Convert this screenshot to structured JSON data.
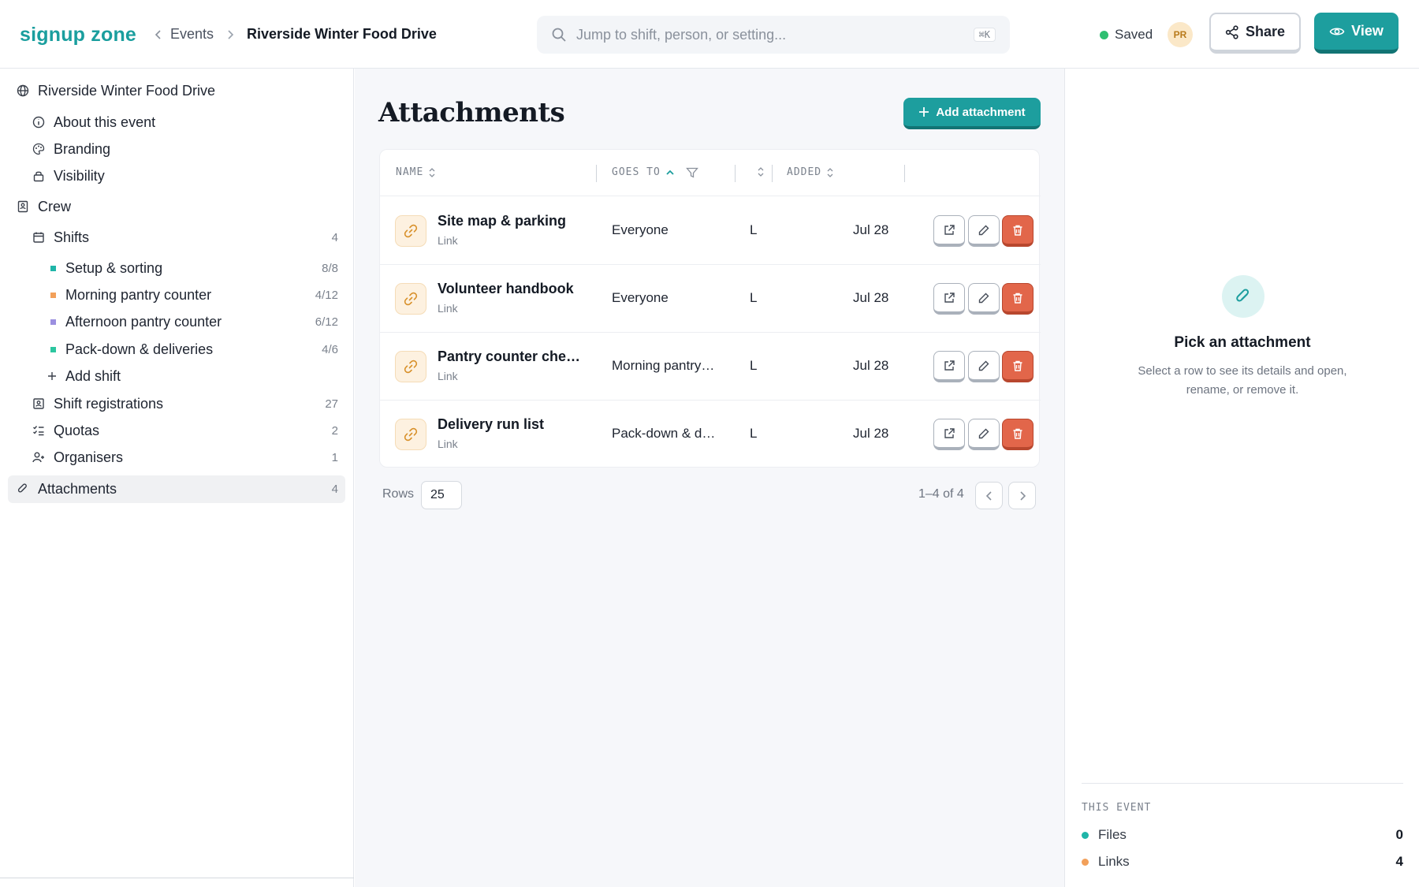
{
  "app": {
    "logo": "signup zone"
  },
  "breadcrumb": {
    "parent": "Events",
    "current": "Riverside Winter Food Drive"
  },
  "search": {
    "placeholder": "Jump to shift, person, or setting...",
    "shortcut": "⌘K"
  },
  "status": {
    "saved": "Saved",
    "avatar": "PR"
  },
  "header_buttons": {
    "share": "Share",
    "view": "View"
  },
  "sidebar": {
    "event": "Riverside Winter Food Drive",
    "about": "About this event",
    "branding": "Branding",
    "visibility": "Visibility",
    "crew": "Crew",
    "shifts": {
      "label": "Shifts",
      "count": "4"
    },
    "shift_items": [
      {
        "label": "Setup & sorting",
        "count": "8/8",
        "color": "#1fb5a8"
      },
      {
        "label": "Morning pantry counter",
        "count": "4/12",
        "color": "#f2a05a"
      },
      {
        "label": "Afternoon pantry counter",
        "count": "6/12",
        "color": "#9b8fe0"
      },
      {
        "label": "Pack-down & deliveries",
        "count": "4/6",
        "color": "#2cc6a0"
      }
    ],
    "add_shift": "Add shift",
    "registrations": {
      "label": "Shift registrations",
      "count": "27"
    },
    "quotas": {
      "label": "Quotas",
      "count": "2"
    },
    "organisers": {
      "label": "Organisers",
      "count": "1"
    },
    "attachments": {
      "label": "Attachments",
      "count": "4"
    }
  },
  "main": {
    "title": "Attachments",
    "add_button": "Add attachment",
    "columns": {
      "name": "NAME",
      "goes_to": "GOES TO",
      "added": "ADDED"
    },
    "rows": [
      {
        "name": "Site map & parking",
        "type": "Link",
        "goes_to": "Everyone",
        "l": "L",
        "added": "Jul 28"
      },
      {
        "name": "Volunteer handbook",
        "type": "Link",
        "goes_to": "Everyone",
        "l": "L",
        "added": "Jul 28"
      },
      {
        "name": "Pantry counter checklist",
        "type": "Link",
        "goes_to": "Morning pantry counter",
        "l": "L",
        "added": "Jul 28"
      },
      {
        "name": "Delivery run list",
        "type": "Link",
        "goes_to": "Pack-down & deliveries",
        "l": "L",
        "added": "Jul 28"
      }
    ],
    "footer": {
      "rows_label": "Rows",
      "rows_value": "25",
      "range": "1–4 of 4"
    }
  },
  "right_panel": {
    "title": "Pick an attachment",
    "subtitle": "Select a row to see its details and open, rename, or remove it.",
    "section": "THIS EVENT",
    "stats": [
      {
        "label": "Files",
        "value": "0",
        "color": "#1fb5a8"
      },
      {
        "label": "Links",
        "value": "4",
        "color": "#f2a05a"
      }
    ]
  },
  "colors": {
    "accent": "#1d9e9e",
    "danger": "#e2664a"
  }
}
